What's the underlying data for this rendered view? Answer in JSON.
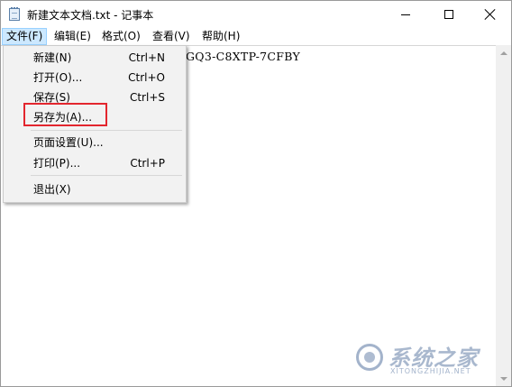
{
  "window": {
    "title": "新建文本文档.txt - 记事本",
    "icon": "notepad-icon"
  },
  "menubar": {
    "file": "文件(F)",
    "edit": "编辑(E)",
    "format": "格式(O)",
    "view": "查看(V)",
    "help": "帮助(H)"
  },
  "editor": {
    "text": "GQ3-C8XTP-7CFBY"
  },
  "file_menu": {
    "items": [
      {
        "label": "新建(N)",
        "shortcut": "Ctrl+N"
      },
      {
        "label": "打开(O)...",
        "shortcut": "Ctrl+O"
      },
      {
        "label": "保存(S)",
        "shortcut": "Ctrl+S"
      },
      {
        "label": "另存为(A)...",
        "shortcut": ""
      },
      {
        "label": "页面设置(U)...",
        "shortcut": ""
      },
      {
        "label": "打印(P)...",
        "shortcut": "Ctrl+P"
      },
      {
        "label": "退出(X)",
        "shortcut": ""
      }
    ]
  },
  "highlight_color": "#e3262e",
  "watermark": {
    "text": "系统之家",
    "sub": "XITONGZHIJIA.NET"
  }
}
